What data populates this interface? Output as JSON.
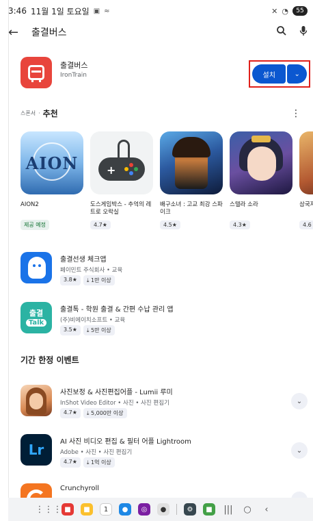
{
  "status": {
    "time": "3:46",
    "date": "11월 1일 토요일",
    "battery": "55"
  },
  "topbar": {
    "title": "출결버스",
    "back_icon": "arrow-left-icon",
    "search_icon": "search-icon",
    "mic_icon": "microphone-icon"
  },
  "app": {
    "name": "출결버스",
    "developer": "IronTrain",
    "install_label": "설치",
    "install_more_icon": "chevron-down-icon",
    "colors": {
      "logo": "#e8453c",
      "install": "#0b57d0",
      "highlight": "#e0201a"
    }
  },
  "sponsored": {
    "ad_label": "스폰서",
    "separator": "·",
    "heading": "추천",
    "more_icon": "more-vertical-icon"
  },
  "carousel": [
    {
      "name": "AION2",
      "badge": "제공 예정"
    },
    {
      "name": "도스게임박스 - 추억의 레트로 오락실",
      "rating": "4.7★"
    },
    {
      "name": "배구소녀 : 고교 최강 스파이크",
      "rating": "4.5★"
    },
    {
      "name": "스텔라 소라",
      "rating": "4.3★"
    },
    {
      "name": "삼국지",
      "rating": "4.6"
    }
  ],
  "apps": [
    {
      "title": "출결선생 체크앱",
      "sub": "페이민트 주식회사 • 교육",
      "rating": "3.8★",
      "downloads": "⤓ 1만 이상"
    },
    {
      "title": "출결톡 - 학원 출결 & 간편 수납 관리 앱",
      "sub": "(주)비에이치소프트 • 교육",
      "rating": "3.5★",
      "downloads": "⤓ 5만 이상",
      "icon_text_top": "출결",
      "icon_text_bottom": "Talk"
    }
  ],
  "events": {
    "heading": "기간 한정 이벤트",
    "items": [
      {
        "title": "사진보정 & 사진편집어플 - Lumii 루미",
        "sub": "InShot Video Editor • 사진 • 사진 편집기",
        "rating": "4.7★",
        "downloads": "⤓ 5,000만 이상"
      },
      {
        "title": "AI 사진 비디오 편집 & 필터 어플 Lightroom",
        "sub": "Adobe • 사진 • 사진 편집기",
        "rating": "4.7★",
        "downloads": "⤓ 1억 이상",
        "icon_text": "Lr"
      },
      {
        "title": "Crunchyroll"
      }
    ]
  }
}
